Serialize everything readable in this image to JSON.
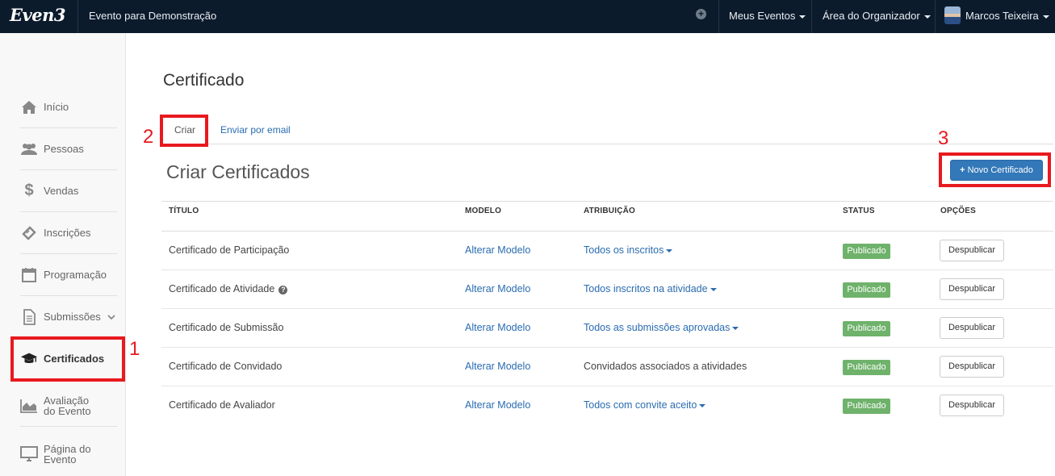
{
  "topbar": {
    "logo": "Even3",
    "event_name": "Evento para Demonstração",
    "meus_eventos": "Meus Eventos",
    "area_organizador": "Área do Organizador",
    "user_name": "Marcos Teixeira"
  },
  "sidebar": {
    "items": [
      {
        "label": "Início",
        "icon": "home-icon"
      },
      {
        "label": "Pessoas",
        "icon": "users-icon"
      },
      {
        "label": "Vendas",
        "icon": "dollar-icon"
      },
      {
        "label": "Inscrições",
        "icon": "ticket-icon"
      },
      {
        "label": "Programação",
        "icon": "calendar-icon"
      },
      {
        "label": "Submissões",
        "icon": "document-icon"
      },
      {
        "label": "Certificados",
        "icon": "graduation-cap-icon"
      },
      {
        "label_line1": "Avaliação",
        "label_line2": "do Evento",
        "icon": "area-chart-icon"
      },
      {
        "label_line1": "Página do",
        "label_line2": "Evento",
        "icon": "monitor-icon"
      }
    ]
  },
  "annotations": {
    "one": "1",
    "two": "2",
    "three": "3"
  },
  "main": {
    "page_title": "Certificado",
    "tabs": [
      {
        "label": "Criar"
      },
      {
        "label": "Enviar por email"
      }
    ],
    "section_title": "Criar Certificados",
    "new_button": "Novo Certificado",
    "table": {
      "headers": [
        "TÍTULO",
        "MODELO",
        "ATRIBUIÇÃO",
        "STATUS",
        "OPÇÕES"
      ],
      "rows": [
        {
          "title": "Certificado de Participação",
          "model": "Alterar Modelo",
          "attribution": "Todos os inscritos",
          "status": "Publicado",
          "action": "Despublicar"
        },
        {
          "title": "Certificado de Atividade",
          "model": "Alterar Modelo",
          "attribution": "Todos inscritos na atividade",
          "status": "Publicado",
          "action": "Despublicar"
        },
        {
          "title": "Certificado de Submissão",
          "model": "Alterar Modelo",
          "attribution": "Todos as submissões aprovadas",
          "status": "Publicado",
          "action": "Despublicar"
        },
        {
          "title": "Certificado de Convidado",
          "model": "Alterar Modelo",
          "attribution": "Convidados associados a atividades",
          "status": "Publicado",
          "action": "Despublicar"
        },
        {
          "title": "Certificado de Avaliador",
          "model": "Alterar Modelo",
          "attribution": "Todos com convite aceito",
          "status": "Publicado",
          "action": "Despublicar"
        }
      ]
    }
  },
  "colors": {
    "topbar": "#0c1b2c",
    "primary": "#3378b9",
    "link": "#2a6cb0",
    "success": "#6fb26b",
    "annotation": "#e8191f"
  }
}
